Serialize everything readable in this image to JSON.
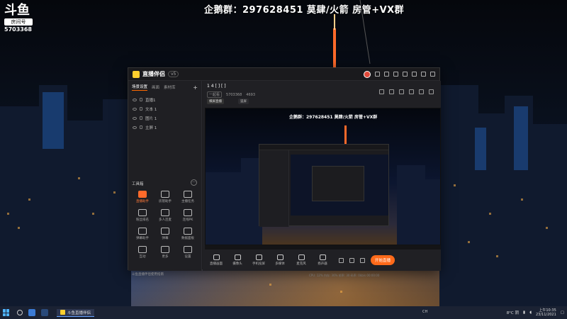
{
  "overlay": {
    "title": "企鹅群：297628451 莫肆/火箭 房管+VX群"
  },
  "badge": {
    "logo": "斗鱼",
    "tag": "房间号",
    "room_id": "5703368"
  },
  "app": {
    "name": "直播伴侣",
    "version": "v5",
    "left_tabs": [
      "场景设置",
      "画面",
      "素材库"
    ],
    "scenes": [
      "直播1",
      "文本 1",
      "图片 1",
      "主屏 1"
    ],
    "toolbox_title": "工具箱",
    "tools": [
      {
        "label": "直播助手",
        "hot": true
      },
      {
        "label": "房管助手",
        "hot": false
      },
      {
        "label": "主播任务",
        "hot": false
      },
      {
        "label": "粉丝排名",
        "hot": false
      },
      {
        "label": "多人连麦",
        "hot": false
      },
      {
        "label": "连线PK",
        "hot": false
      },
      {
        "label": "弹幕助手",
        "hot": false
      },
      {
        "label": "弹幕",
        "hot": false
      },
      {
        "label": "数据面板",
        "hot": false
      },
      {
        "label": "互动",
        "hot": false
      },
      {
        "label": "更多",
        "hot": false
      },
      {
        "label": "设置",
        "hot": false
      }
    ],
    "bottom_note": "斗鱼直播伴侣使用指南",
    "stream": {
      "title": "1 4 [ ] [ ]",
      "category": "一起看",
      "room": "5703368",
      "viewers": "4693",
      "live_tag": "横屏直播",
      "plain_tag": "竖屏"
    },
    "preview_title": "企鹅群：297628451 莫肆/火箭 房管+VX群",
    "controls": [
      "直播画面",
      "摄像头",
      "手机投屏",
      "多媒体",
      "麦克风",
      "扬声器"
    ],
    "start_button": "开始直播",
    "status": "CPU: 12%    内存: 36%    帧率: 30    码率: 0kb/s    00:00:00"
  },
  "taskbar": {
    "search_placeholder": "",
    "app_label": "斗鱼直播伴侣",
    "input": "CH",
    "weather": "8°C 阴",
    "time": "上午10:35",
    "date": "23/11/2021"
  }
}
